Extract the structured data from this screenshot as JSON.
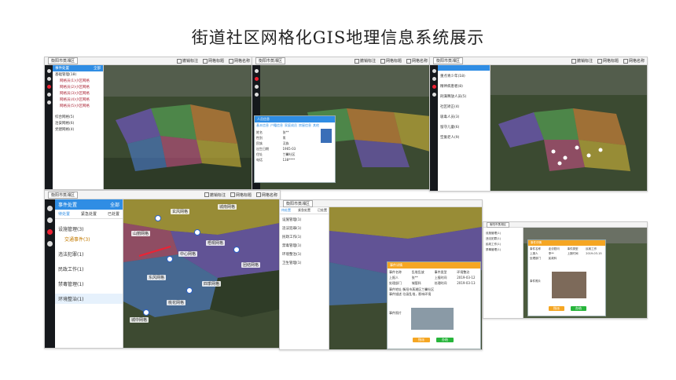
{
  "page": {
    "title": "街道社区网格化GIS地理信息系统展示"
  },
  "toolbar": {
    "district": "衡阳市蒸湘区",
    "check_1": "撤销标注",
    "check_2": "网格标题",
    "check_3": "网格名称"
  },
  "panel_a": {
    "header": "事件处置",
    "header_right": "全部",
    "items": [
      {
        "label": "基础管理(18)"
      },
      {
        "label": "综合网格(5)"
      },
      {
        "label": "治安网格(6)"
      },
      {
        "label": "党建网格(4)"
      },
      {
        "label": "环境网格(3)"
      }
    ],
    "subs": [
      "网格员(1)小区网格",
      "网格员(2)小区网格",
      "网格员(3)小区网格",
      "网格员(4)小区网格",
      "网格员(5)小区网格"
    ]
  },
  "panel_b": {
    "popup_title": "人员信息",
    "tabs": [
      "基本信息",
      "户籍信息",
      "家庭成员",
      "房屋信息",
      "其他"
    ],
    "fields": [
      "姓名",
      "张**",
      "性别",
      "男",
      "民族",
      "汉族",
      "出生日期",
      "1965-03",
      "住址",
      "兰馨社区",
      "电话",
      "138****"
    ]
  },
  "panel_c": {
    "items": [
      "重点青少年(18)",
      "精神病患者(8)",
      "刑满释放人员(5)",
      "社区矫正(4)",
      "吸毒人员(3)",
      "留守儿童(6)",
      "空巢老人(9)"
    ]
  },
  "panel_d": {
    "header": "事件处置",
    "header_right": "全部",
    "tabs": [
      "待处置",
      "紧急处置",
      "已处置"
    ],
    "items": [
      {
        "label": "设施管理(3)",
        "sub": "交通事件(3)"
      },
      {
        "label": "违法犯罪(1)"
      },
      {
        "label": "民政工作(1)"
      },
      {
        "label": "禁毒管理(1)"
      },
      {
        "label": "环境整治(1)"
      }
    ],
    "map_labels": [
      "玄风网格",
      "城南网格",
      "山丽网格",
      "梧桐网格",
      "中心网格",
      "团结网格",
      "东风网格",
      "四季网格",
      "桃花网格",
      "城中网格"
    ]
  },
  "panel_e": {
    "tabs": [
      "待处置",
      "紧急处置",
      "已处置"
    ],
    "items": [
      "设施管理(1)",
      "违法犯罪(1)",
      "民政工作(1)",
      "禁毒管理(1)",
      "环境整治(1)",
      "卫生管理(1)"
    ],
    "popup_title": "事件详情",
    "fields": [
      "事件名称",
      "乱堆乱放",
      "事件类型",
      "环境整治",
      "上报人",
      "张**",
      "上报时间",
      "2019-03-12",
      "处理部门",
      "城管科",
      "处理时间",
      "2019-03-13"
    ],
    "address_label": "事件地址",
    "address": "衡阳市蒸湘区兰馨社区",
    "desc_label": "事件描述",
    "desc": "垃圾乱堆，影响环境",
    "photo_label": "事件照片",
    "btn_1": "指派",
    "btn_2": "办结"
  },
  "panel_f": {
    "popup_title": "事件详情",
    "fields": [
      "事件名称",
      "走访慰问",
      "事件类型",
      "民政工作",
      "上报人",
      "李**",
      "上报时间",
      "2019-03-15",
      "处理部门",
      "民政科"
    ],
    "photo_label": "事件照片",
    "btn_1": "指派",
    "btn_2": "办结"
  },
  "colors": {
    "header_blue": "#2f8de4",
    "popup_orange": "#f5a623",
    "btn_green": "#27b53b",
    "zone_yellow": "#e3c23a",
    "zone_purple": "#7a5ad8",
    "zone_pink": "#d4508c",
    "zone_orange": "#e38a3a",
    "zone_blue": "#4e84e2",
    "zone_green": "#5db85d"
  },
  "icons": [
    "search-icon",
    "map-pin-icon",
    "user-icon",
    "alarm-icon",
    "menu-icon",
    "settings-icon"
  ]
}
